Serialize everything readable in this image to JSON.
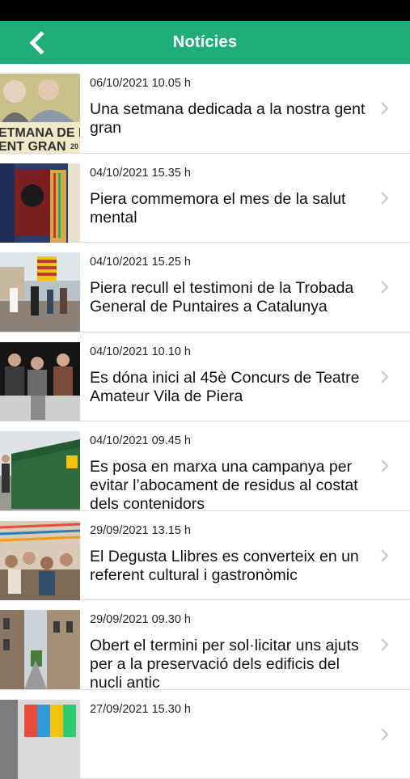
{
  "header": {
    "title": "Notícies",
    "back_icon": "chevron-left-icon",
    "background": "#1fad7a"
  },
  "news": [
    {
      "date": "06/10/2021 10.05 h",
      "title": "Una setmana dedicada a la nostra gent gran",
      "thumb_text_1": "ETMANA DE L",
      "thumb_text_2": "ENT GRAN",
      "thumb_text_3": "20"
    },
    {
      "date": "04/10/2021 15.35 h",
      "title": "Piera commemora el mes de la salut mental"
    },
    {
      "date": "04/10/2021 15.25 h",
      "title": "Piera recull el testimoni de la Trobada General de Puntaires a Catalunya"
    },
    {
      "date": "04/10/2021 10.10 h",
      "title": "Es dóna inici al 45è Concurs de Teatre Amateur Vila de Piera"
    },
    {
      "date": "04/10/2021 09.45 h",
      "title": "Es posa en marxa una campanya per evitar l’abocament de residus al costat dels contenidors"
    },
    {
      "date": "29/09/2021 13.15 h",
      "title": "El Degusta Llibres es converteix en un referent cultural i gastronòmic"
    },
    {
      "date": "29/09/2021 09.30 h",
      "title": "Obert el termini per sol·licitar uns ajuts per a la preservació dels edificis del nucli antic"
    },
    {
      "date": "27/09/2021 15.30 h",
      "title": ""
    }
  ]
}
